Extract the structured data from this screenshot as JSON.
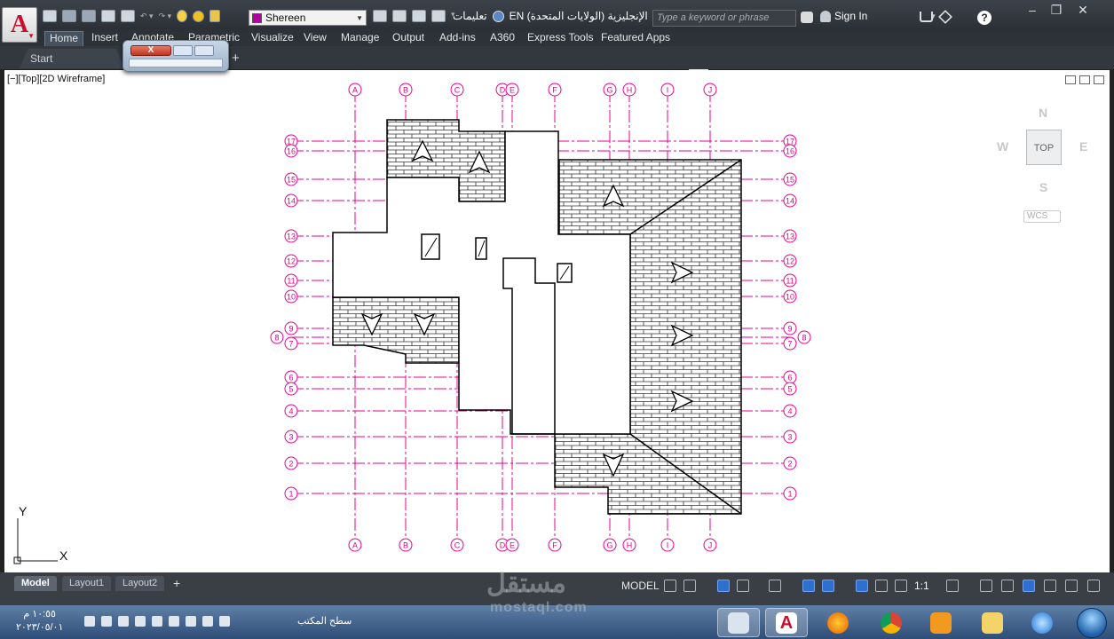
{
  "titlebar": {
    "layer_name": "Shereen",
    "layer_color": "#b4009e",
    "workspace_label": "تعليمات",
    "language_label": "EN الإنجليزية (الولايات المتحدة)",
    "search_placeholder": "Type a keyword or phrase",
    "signin_label": "Sign In",
    "help_label": "?"
  },
  "ribbon": {
    "tabs": [
      "Home",
      "Insert",
      "Annotate",
      "Parametric",
      "Visualize",
      "View",
      "Manage",
      "Output",
      "Add-ins",
      "A360",
      "Express Tools",
      "Featured Apps"
    ],
    "active_tab": "Home"
  },
  "file_tabs": {
    "start": "Start",
    "add": "+"
  },
  "float_window": {
    "close": "X"
  },
  "viewport": {
    "label": "[−][Top][2D Wireframe]",
    "viewcube": {
      "north": "N",
      "south": "S",
      "east": "E",
      "west": "W",
      "face": "TOP",
      "wcs": "WCS"
    }
  },
  "drawing": {
    "grid_color": "#e8008c",
    "letters_top": [
      "A",
      "B",
      "C",
      "D",
      "E",
      "F",
      "G",
      "H",
      "I",
      "J"
    ],
    "numbers_left": [
      "17",
      "16",
      "15",
      "14",
      "13",
      "12",
      "11",
      "10",
      "9",
      "8",
      "7",
      "6",
      "5",
      "4",
      "3",
      "2",
      "1"
    ],
    "ucs": {
      "x": "X",
      "y": "Y"
    }
  },
  "layout_tabs": [
    "Model",
    "Layout1",
    "Layout2"
  ],
  "status": {
    "model": "MODEL",
    "scale": "1:1"
  },
  "taskbar": {
    "time": "١٠:٥٥ م",
    "date": "٢٠٢٣/٠٥/٠١",
    "desktop": "سطح المكتب"
  },
  "watermark": {
    "arabic": "مستقل",
    "latin": "mostaql.com"
  }
}
